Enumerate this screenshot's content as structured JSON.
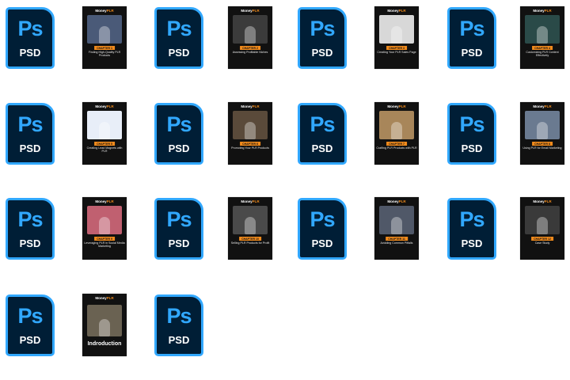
{
  "psd_icon": {
    "logo": "Ps",
    "ext": "PSD",
    "colors": {
      "background": "#001e36",
      "accent": "#31a8ff"
    }
  },
  "brand": {
    "prefix": "Money",
    "suffix": "PLR"
  },
  "accent_color": "#f08a1c",
  "thumbnails": [
    {
      "chapter": "CHAPTER 1",
      "title": "Finding High-Quality PLR Products",
      "art_color": "#4a5a78"
    },
    {
      "chapter": "CHAPTER 2",
      "title": "Assessing Profitable Niches",
      "art_color": "#3b3b3b"
    },
    {
      "chapter": "CHAPTER 3",
      "title": "Creating Your PLR Sales Page",
      "art_color": "#d8d8d8"
    },
    {
      "chapter": "CHAPTER 4",
      "title": "Customizing PLR Content Effectively",
      "art_color": "#2a4a48"
    },
    {
      "chapter": "CHAPTER 5",
      "title": "Creating Lead Magnets with PLR",
      "art_color": "#e8eef8"
    },
    {
      "chapter": "CHAPTER 6",
      "title": "Promoting Your PLR Products",
      "art_color": "#5a4a3a"
    },
    {
      "chapter": "CHAPTER 7",
      "title": "Crafting PLR Products with PLR",
      "art_color": "#a8865a"
    },
    {
      "chapter": "CHAPTER 8",
      "title": "Using PLR for Email Marketing",
      "art_color": "#6a7a90"
    },
    {
      "chapter": "CHAPTER 9",
      "title": "Leveraging PLR in Social Media Marketing",
      "art_color": "#c06070"
    },
    {
      "chapter": "CHAPTER 10",
      "title": "Selling PLR Products for Profit",
      "art_color": "#4a4a4a"
    },
    {
      "chapter": "CHAPTER 11",
      "title": "Avoiding Common Pitfalls",
      "art_color": "#505868"
    },
    {
      "chapter": "CHAPTER 12",
      "title": "Case Study",
      "art_color": "#3a3a3a"
    },
    {
      "chapter": "",
      "title": "Indroduction",
      "art_color": "#6a6252",
      "is_intro": true
    }
  ]
}
